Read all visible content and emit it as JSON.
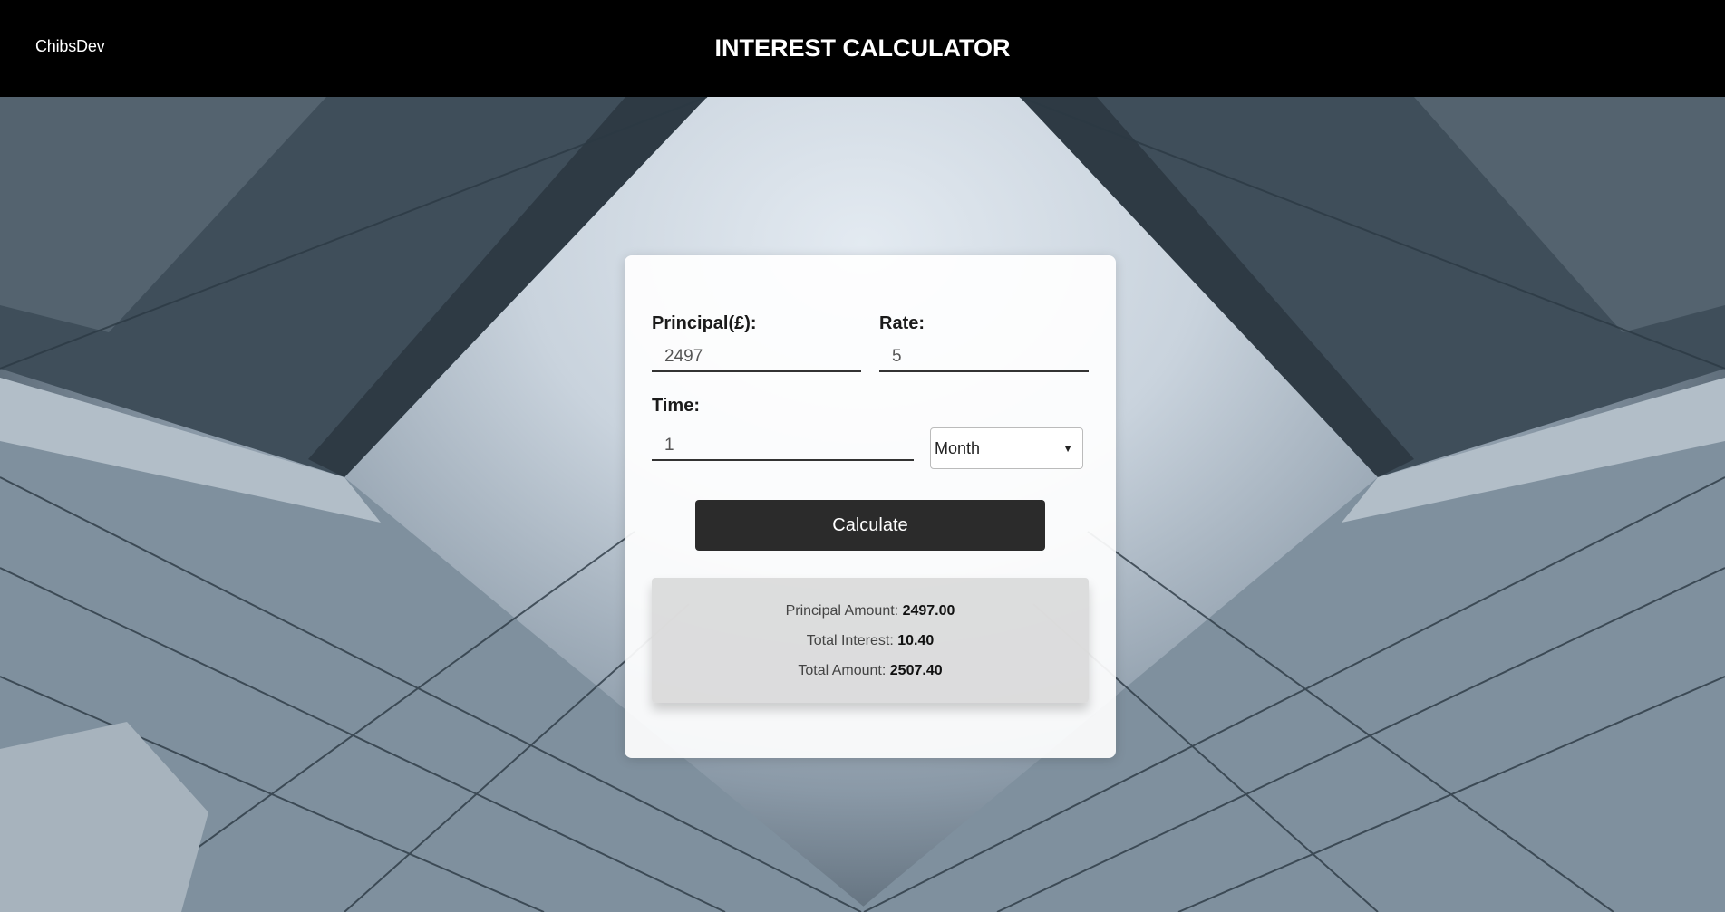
{
  "header": {
    "brand": "ChibsDev",
    "title": "INTEREST CALCULATOR"
  },
  "form": {
    "principal_label": "Principal(£):",
    "principal_value": "2497",
    "rate_label": "Rate:",
    "rate_value": "5",
    "time_label": "Time:",
    "time_value": "1",
    "period_selected": "Month",
    "calculate_label": "Calculate"
  },
  "results": {
    "principal_label": "Principal Amount:",
    "principal_value": "2497.00",
    "interest_label": "Total Interest:",
    "interest_value": "10.40",
    "total_label": "Total Amount:",
    "total_value": "2507.40"
  },
  "colors": {
    "navbar": "#000000",
    "button": "#2b2b2b",
    "card": "#ffffff"
  }
}
